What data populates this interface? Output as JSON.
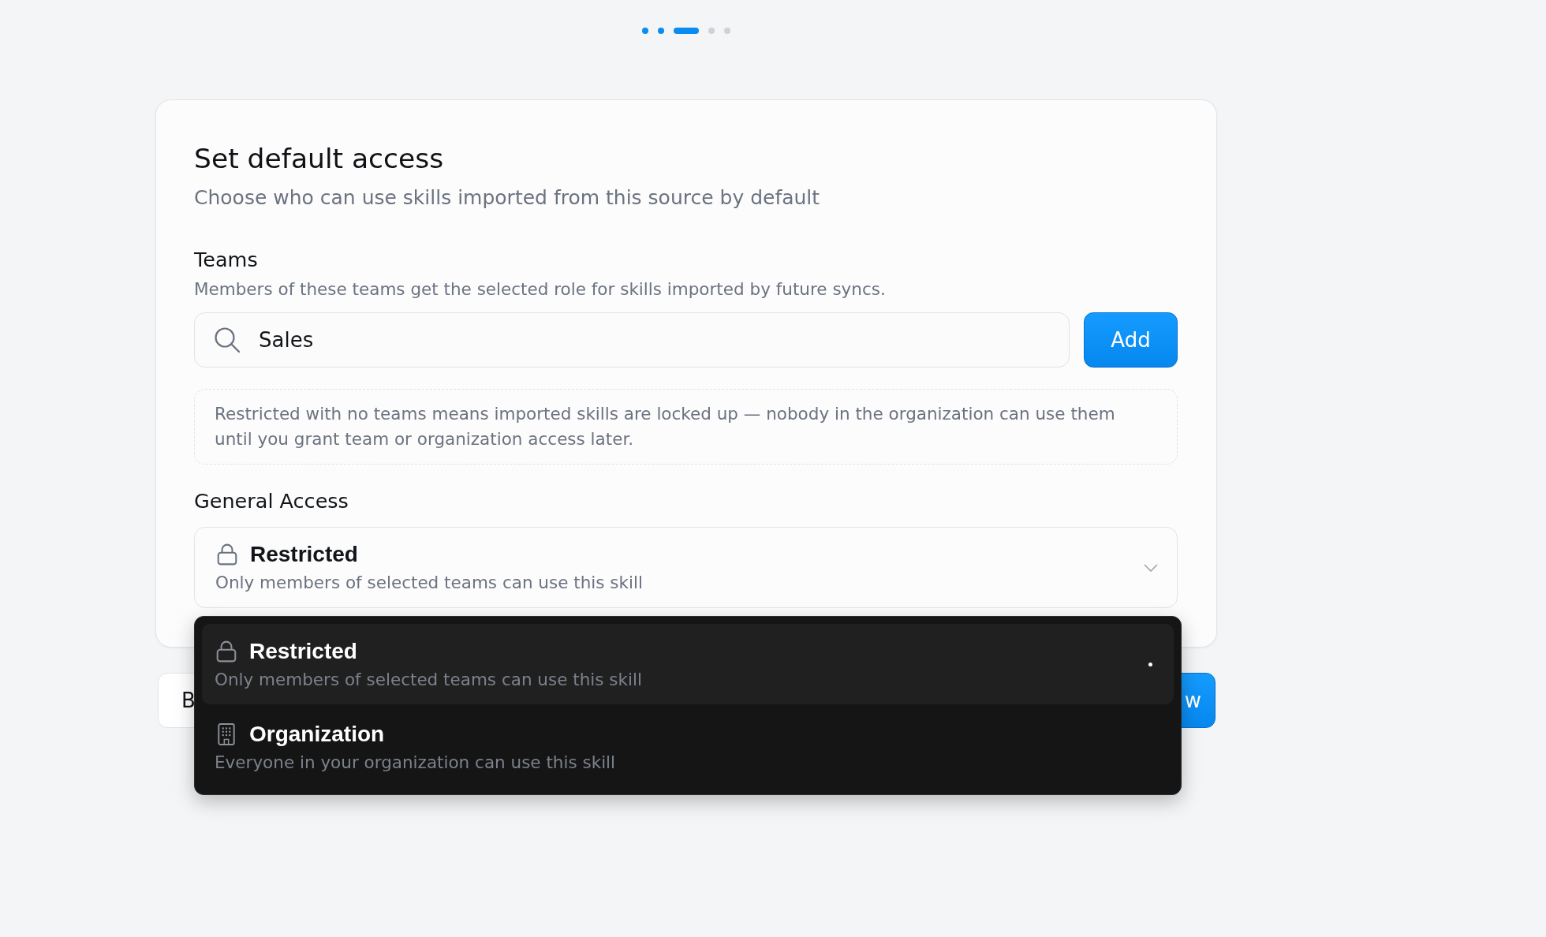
{
  "steps": [
    {
      "kind": "completed"
    },
    {
      "kind": "completed"
    },
    {
      "kind": "current"
    },
    {
      "kind": "upcoming"
    },
    {
      "kind": "upcoming"
    }
  ],
  "card": {
    "title": "Set default access",
    "subtitle": "Choose who can use skills imported from this source by default",
    "teams": {
      "label": "Teams",
      "description": "Members of these teams get the selected role for skills imported by future syncs.",
      "search": {
        "value": "Sales"
      },
      "add_button": "Add",
      "note": "Restricted with no teams means imported skills are locked up — nobody in the organization can use them until you grant team or organization access later."
    },
    "general_access": {
      "label": "General Access",
      "select": {
        "kind": "restricted",
        "title": "Restricted",
        "description": "Only members of selected teams can use this skill",
        "expanded": true
      },
      "options": [
        {
          "kind": "restricted",
          "title": "Restricted",
          "description": "Only members of selected teams can use this skill",
          "selected": true
        },
        {
          "kind": "organization",
          "title": "Organization",
          "description": "Everyone in your organization can use this skill",
          "selected": false
        }
      ]
    }
  },
  "footer": {
    "buttons": [
      {
        "kind": "secondary",
        "label": "B"
      },
      {
        "kind": "primary",
        "label": "w"
      }
    ]
  }
}
